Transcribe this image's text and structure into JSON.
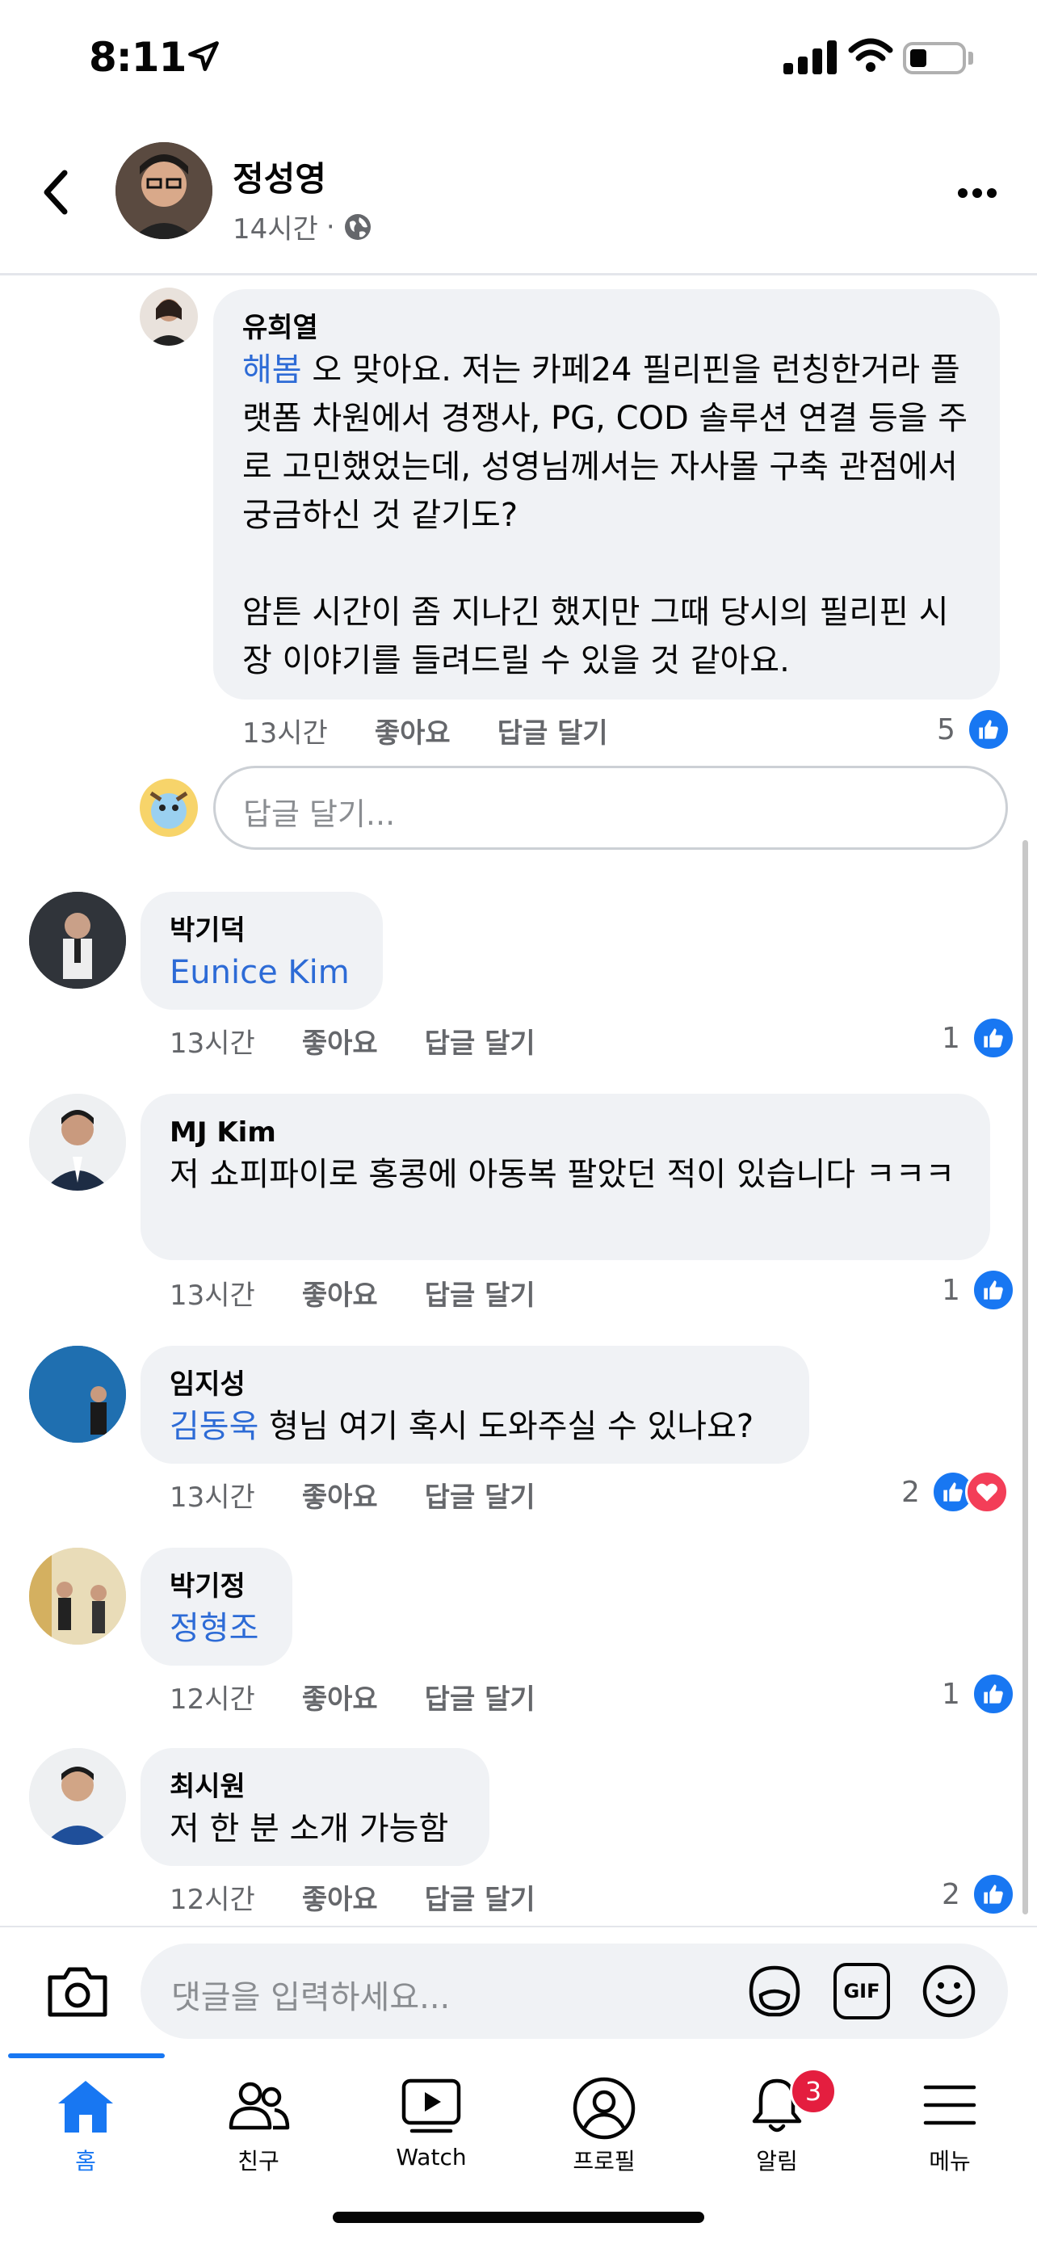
{
  "status": {
    "time": "8:11"
  },
  "header": {
    "author": "정성영",
    "time": "14시간",
    "separator": "·"
  },
  "comments": [
    {
      "name": "유희열",
      "mention": "해봄",
      "text": " 오 맞아요. 저는 카페24 필리핀을 런칭한거라 플랫폼 차원에서 경쟁사, PG, COD 솔루션 연결 등을 주로 고민했었는데, 성영님께서는 자사몰 구축 관점에서 궁금하신 것 같기도?\n\n암튼 시간이 좀 지나긴 했지만 그때 당시의 필리핀 시장 이야기를 들려드릴 수 있을 것 같아요.",
      "time": "13시간",
      "like": "좋아요",
      "reply": "답글 달기",
      "count": "5"
    },
    {
      "name": "박기덕",
      "mention": "Eunice Kim",
      "text": "",
      "time": "13시간",
      "like": "좋아요",
      "reply": "답글 달기",
      "count": "1"
    },
    {
      "name": "MJ Kim",
      "mention": "",
      "text": "저 쇼피파이로 홍콩에 아동복 팔았던 적이 있습니다 ㅋㅋㅋ",
      "time": "13시간",
      "like": "좋아요",
      "reply": "답글 달기",
      "count": "1"
    },
    {
      "name": "임지성",
      "mention": "김동욱",
      "text": " 형님 여기 혹시 도와주실 수 있나요?",
      "time": "13시간",
      "like": "좋아요",
      "reply": "답글 달기",
      "count": "2"
    },
    {
      "name": "박기정",
      "mention": "정형조",
      "text": "",
      "time": "12시간",
      "like": "좋아요",
      "reply": "답글 달기",
      "count": "1"
    },
    {
      "name": "최시원",
      "mention": "",
      "text": "저 한 분 소개 가능함",
      "time": "12시간",
      "like": "좋아요",
      "reply": "답글 달기",
      "count": "2"
    }
  ],
  "reply_input": {
    "placeholder": "답글 달기..."
  },
  "composer": {
    "placeholder": "댓글을 입력하세요...",
    "gif_label": "GIF"
  },
  "tabs": [
    {
      "label": "홈",
      "icon": "home-icon",
      "active": true
    },
    {
      "label": "친구",
      "icon": "friends-icon"
    },
    {
      "label": "Watch",
      "icon": "watch-icon"
    },
    {
      "label": "프로필",
      "icon": "profile-icon"
    },
    {
      "label": "알림",
      "icon": "bell-icon",
      "badge": "3"
    },
    {
      "label": "메뉴",
      "icon": "menu-icon"
    }
  ],
  "colors": {
    "accent": "#1877f2",
    "mention": "#2d6bd6",
    "bubble": "#f0f2f5",
    "heart": "#f33e58",
    "badge": "#e41e3f"
  }
}
